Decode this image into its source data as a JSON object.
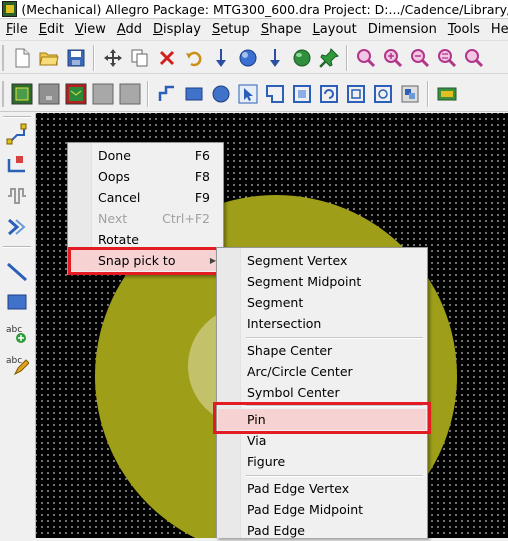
{
  "window": {
    "title": "(Mechanical) Allegro Package: MTG300_600.dra  Project: D:.../Cadence/Library/FTP"
  },
  "menubar": [
    {
      "u": "F",
      "rest": "ile"
    },
    {
      "u": "E",
      "rest": "dit"
    },
    {
      "u": "V",
      "rest": "iew"
    },
    {
      "u": "A",
      "rest": "dd"
    },
    {
      "u": "D",
      "rest": "isplay"
    },
    {
      "u": "S",
      "rest": "etup"
    },
    {
      "u": "S",
      "rest": "hape"
    },
    {
      "u": "L",
      "rest": "ayout"
    },
    {
      "u": "",
      "rest": "Dimension"
    },
    {
      "u": "T",
      "rest": "ools"
    },
    {
      "u": "",
      "rest": "Help"
    }
  ],
  "toolbar1": [
    "new-file-icon",
    "open-folder-icon",
    "save-icon",
    "move-icon",
    "copy-icon",
    "delete-icon",
    "undo-icon",
    "redo-icon",
    "pin-down-icon",
    "pin-down-2-icon",
    "spin-icon",
    "pushpin-icon",
    "zoom-in-icon",
    "zoom-fit-icon",
    "zoom-out-icon",
    "zoom-all-icon"
  ],
  "toolbar2": [
    "layer-visible-icon",
    "layer-gray-icon",
    "layer-board-icon",
    "layer-blank-icon",
    "layer-blank-2-icon",
    "polyline-icon",
    "rectangle-icon",
    "circle-icon",
    "select-arrow-icon",
    "shape-poly-icon",
    "shape-rect-icon",
    "shape-circle-icon",
    "void-rect-icon",
    "void-circle-icon",
    "merge-shapes-icon"
  ],
  "lefttoolbar": [
    "add-connect-icon",
    "slide-icon",
    "delay-tune-icon",
    "route-icon",
    "line-icon",
    "rectangle-icon",
    "add-text-icon",
    "edit-text-icon"
  ],
  "context_menu": {
    "items": [
      {
        "label": "Done",
        "shortcut": "F6",
        "disabled": false
      },
      {
        "label": "Oops",
        "shortcut": "F8",
        "disabled": false
      },
      {
        "label": "Cancel",
        "shortcut": "F9",
        "disabled": false
      },
      {
        "label": "Next",
        "shortcut": "Ctrl+F2",
        "disabled": true
      },
      {
        "label": "Rotate",
        "shortcut": "",
        "disabled": false
      },
      {
        "label": "Snap pick to",
        "shortcut": "",
        "disabled": false
      }
    ]
  },
  "submenu": {
    "items": [
      {
        "label": "Segment Vertex"
      },
      {
        "label": "Segment Midpoint"
      },
      {
        "label": "Segment"
      },
      {
        "label": "Intersection"
      },
      {
        "label": "Shape Center"
      },
      {
        "label": "Arc/Circle Center"
      },
      {
        "label": "Symbol Center"
      },
      {
        "label": "Pin"
      },
      {
        "label": "Via"
      },
      {
        "label": "Figure"
      },
      {
        "label": "Pad Edge Vertex"
      },
      {
        "label": "Pad Edge Midpoint"
      },
      {
        "label": "Pad Edge"
      }
    ]
  },
  "colors": {
    "pad": "#9e9e18",
    "canvas": "#000000",
    "highlight": "#e31b23"
  }
}
